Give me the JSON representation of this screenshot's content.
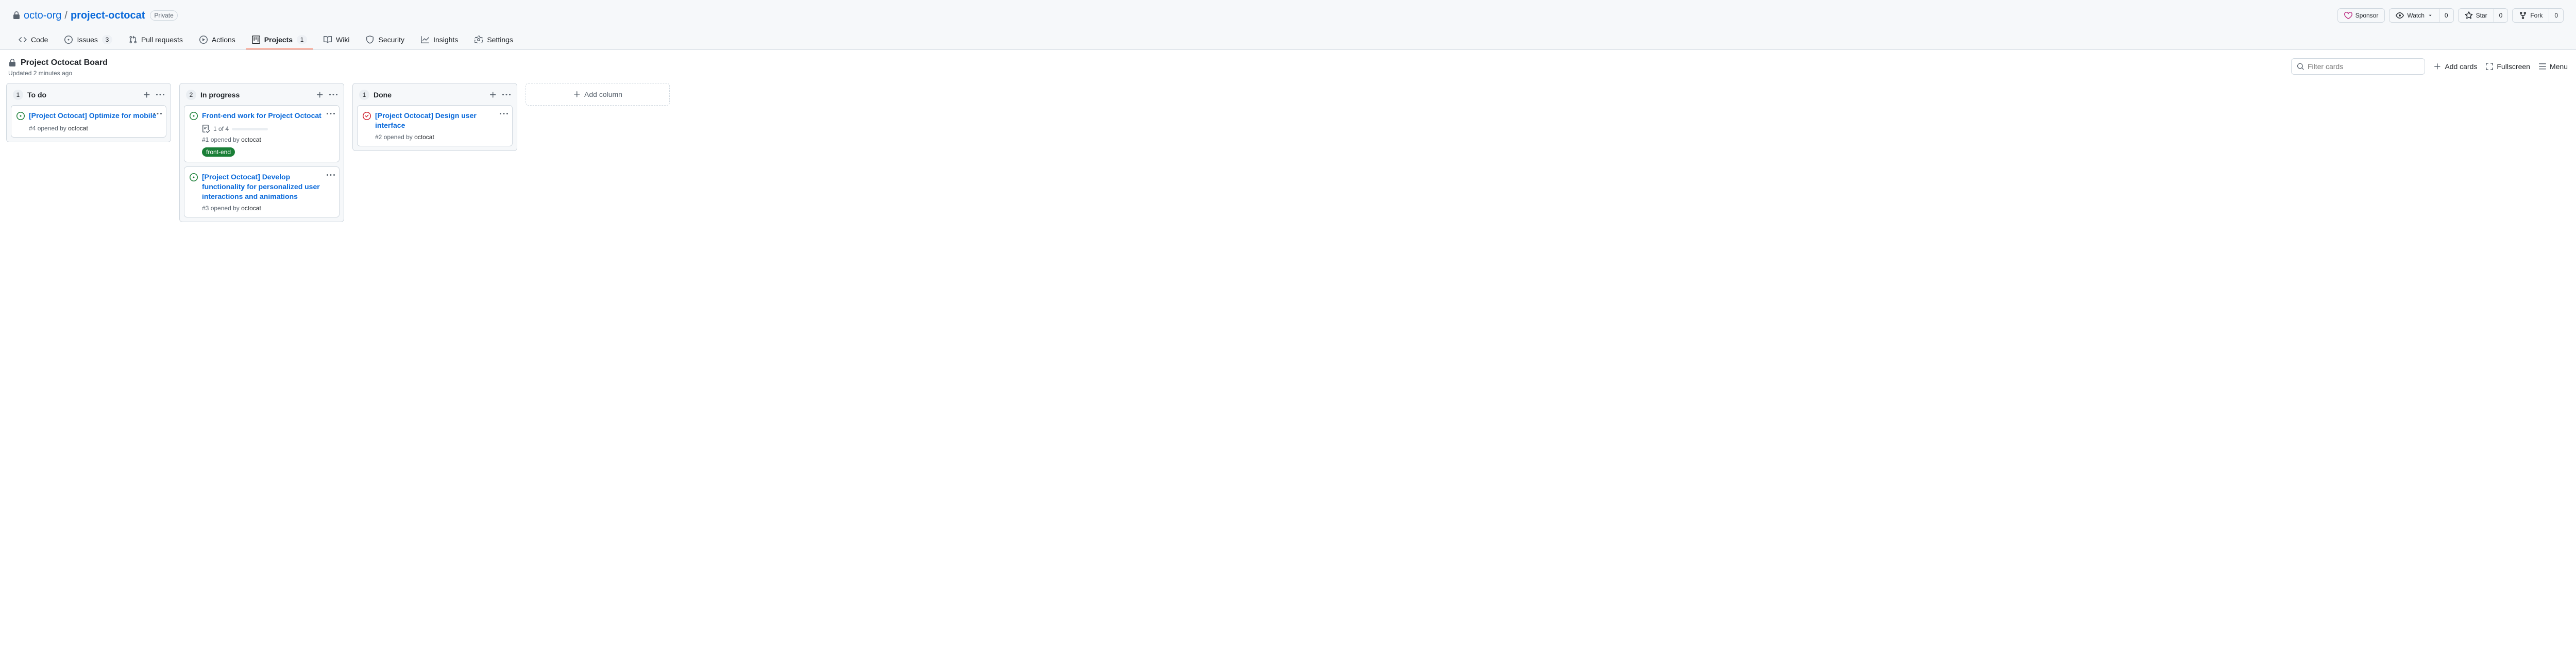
{
  "repo": {
    "owner": "octo-org",
    "name": "project-octocat",
    "visibility": "Private"
  },
  "actions": {
    "sponsor": "Sponsor",
    "watch": "Watch",
    "watch_count": "0",
    "star": "Star",
    "star_count": "0",
    "fork": "Fork",
    "fork_count": "0"
  },
  "nav": {
    "code": "Code",
    "issues": "Issues",
    "issues_count": "3",
    "pulls": "Pull requests",
    "actions": "Actions",
    "projects": "Projects",
    "projects_count": "1",
    "wiki": "Wiki",
    "security": "Security",
    "insights": "Insights",
    "settings": "Settings"
  },
  "project": {
    "title": "Project Octocat Board",
    "updated": "Updated 2 minutes ago",
    "search_placeholder": "Filter cards",
    "add_cards": "Add cards",
    "fullscreen": "Fullscreen",
    "menu": "Menu",
    "add_column": "Add column"
  },
  "columns": [
    {
      "name": "To do",
      "count": "1",
      "cards": [
        {
          "status": "open",
          "title": "[Project Octocat] Optimize for mobile",
          "ref": "#4",
          "verb": "opened by",
          "author": "octocat"
        }
      ]
    },
    {
      "name": "In progress",
      "count": "2",
      "cards": [
        {
          "status": "open",
          "title": "Front-end work for Project Octocat",
          "checklist": "1 of 4",
          "progress_pct": 25,
          "ref": "#1",
          "verb": "opened by",
          "author": "octocat",
          "tag": "front-end"
        },
        {
          "status": "open",
          "title": "[Project Octocat] Develop functionality for personalized user interactions and animations",
          "ref": "#3",
          "verb": "opened by",
          "author": "octocat"
        }
      ]
    },
    {
      "name": "Done",
      "count": "1",
      "cards": [
        {
          "status": "closed",
          "title": "[Project Octocat] Design user interface",
          "ref": "#2",
          "verb": "opened by",
          "author": "octocat"
        }
      ]
    }
  ]
}
